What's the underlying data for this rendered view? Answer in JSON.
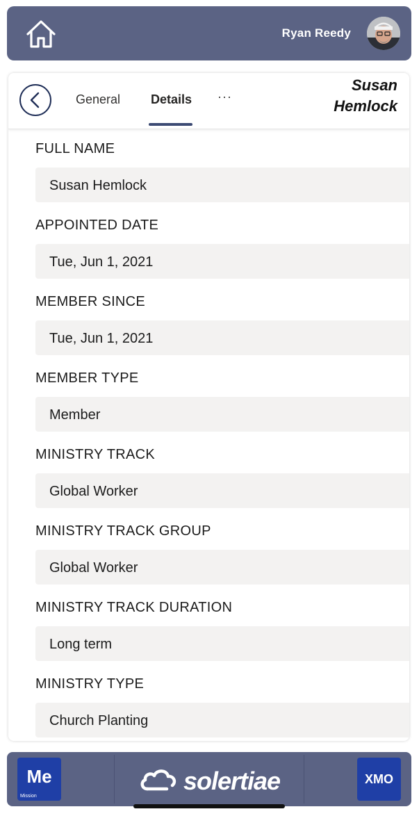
{
  "header": {
    "user_name": "Ryan Reedy",
    "icons": {
      "home": "home-icon",
      "avatar": "user-avatar"
    }
  },
  "record": {
    "person_name_line1": "Susan",
    "person_name_line2": "Hemlock",
    "tabs": [
      {
        "label": "General",
        "active": false
      },
      {
        "label": "Details",
        "active": true
      },
      {
        "label": "···",
        "active": false
      }
    ]
  },
  "fields": [
    {
      "label": "FULL NAME",
      "value": "Susan Hemlock"
    },
    {
      "label": "APPOINTED DATE",
      "value": "Tue, Jun 1, 2021"
    },
    {
      "label": "MEMBER SINCE",
      "value": "Tue, Jun 1, 2021"
    },
    {
      "label": "MEMBER TYPE",
      "value": "Member"
    },
    {
      "label": "MINISTRY TRACK",
      "value": "Global Worker"
    },
    {
      "label": "MINISTRY TRACK GROUP",
      "value": "Global Worker"
    },
    {
      "label": "MINISTRY TRACK DURATION",
      "value": "Long term"
    },
    {
      "label": "MINISTRY TYPE",
      "value": "Church Planting"
    }
  ],
  "footer": {
    "me_tile": "Me",
    "me_subtitle": "Mission",
    "logo_text": "solertiae",
    "xmo_tile": "XMO"
  },
  "colors": {
    "bar": "#5b6384",
    "accent": "#1f2e57",
    "tile": "#1f3fa6",
    "field_bg": "#f3f2f1"
  }
}
